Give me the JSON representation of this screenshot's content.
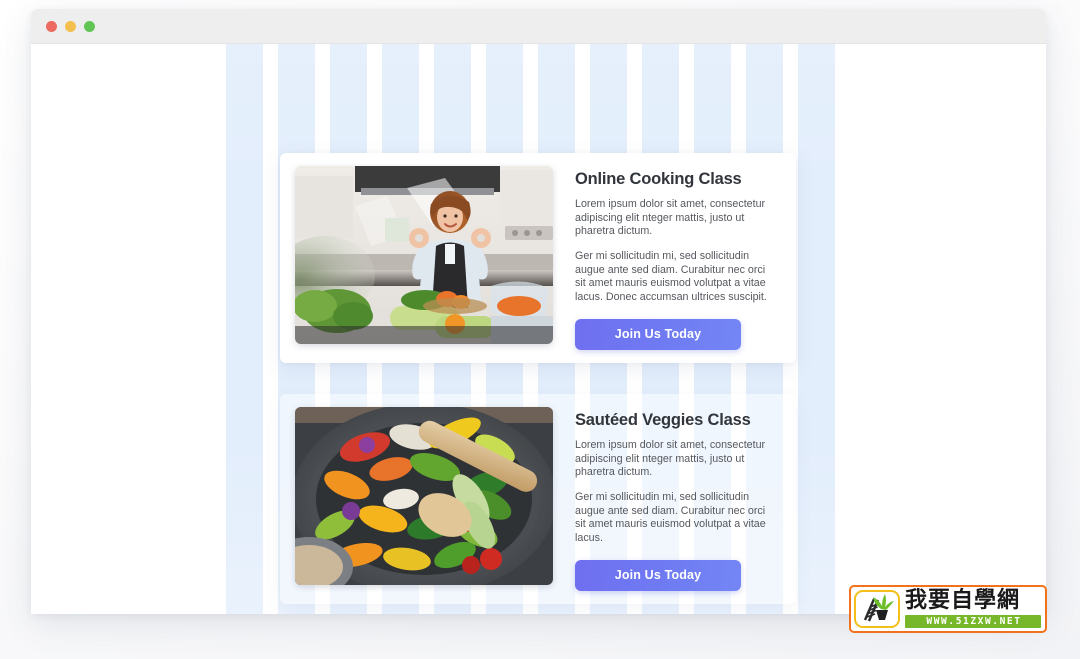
{
  "window": {
    "traffic_lights": [
      {
        "name": "close",
        "color": "#ec6a5f"
      },
      {
        "name": "minimize",
        "color": "#f4bf4f"
      },
      {
        "name": "maximize",
        "color": "#61c555"
      }
    ]
  },
  "theme": {
    "stripe_color": "#e3eefc",
    "stripe_gap_color": "#ffffff",
    "button_color": "#6f7bf2",
    "heading_color": "#32363c",
    "body_text_color": "#55585e",
    "page_background": "#ffffff"
  },
  "cards": [
    {
      "id": "online-cooking-class",
      "title": "Online Cooking Class",
      "paragraphs": [
        "Lorem ipsum dolor sit amet, consectetur adipiscing elit nteger mattis, justo ut pharetra dictum.",
        "Ger mi sollicitudin mi, sed sollicitudin augue ante sed diam. Curabitur nec orci sit amet mauris euismod volutpat a vitae lacus. Donec accumsan ultrices suscipit."
      ],
      "button_label": "Join Us Today",
      "image_alt": "Smiling woman in a kitchen making OK hand gestures with fresh vegetables on the counter"
    },
    {
      "id": "sauteed-veggies-class",
      "title": "Sautéed Veggies Class",
      "paragraphs": [
        "Lorem ipsum dolor sit amet, consectetur adipiscing elit nteger mattis, justo ut pharetra dictum.",
        "Ger mi sollicitudin mi, sed sollicitudin augue ante sed diam. Curabitur nec orci sit amet mauris euismod volutpat a vitae lacus."
      ],
      "button_label": "Join Us Today",
      "image_alt": "Pan of colorful sautéed vegetables being stirred with a wooden spoon"
    }
  ],
  "watermark": {
    "brand_cn": "我要自學網",
    "url": "WWW.51ZXW.NET"
  }
}
